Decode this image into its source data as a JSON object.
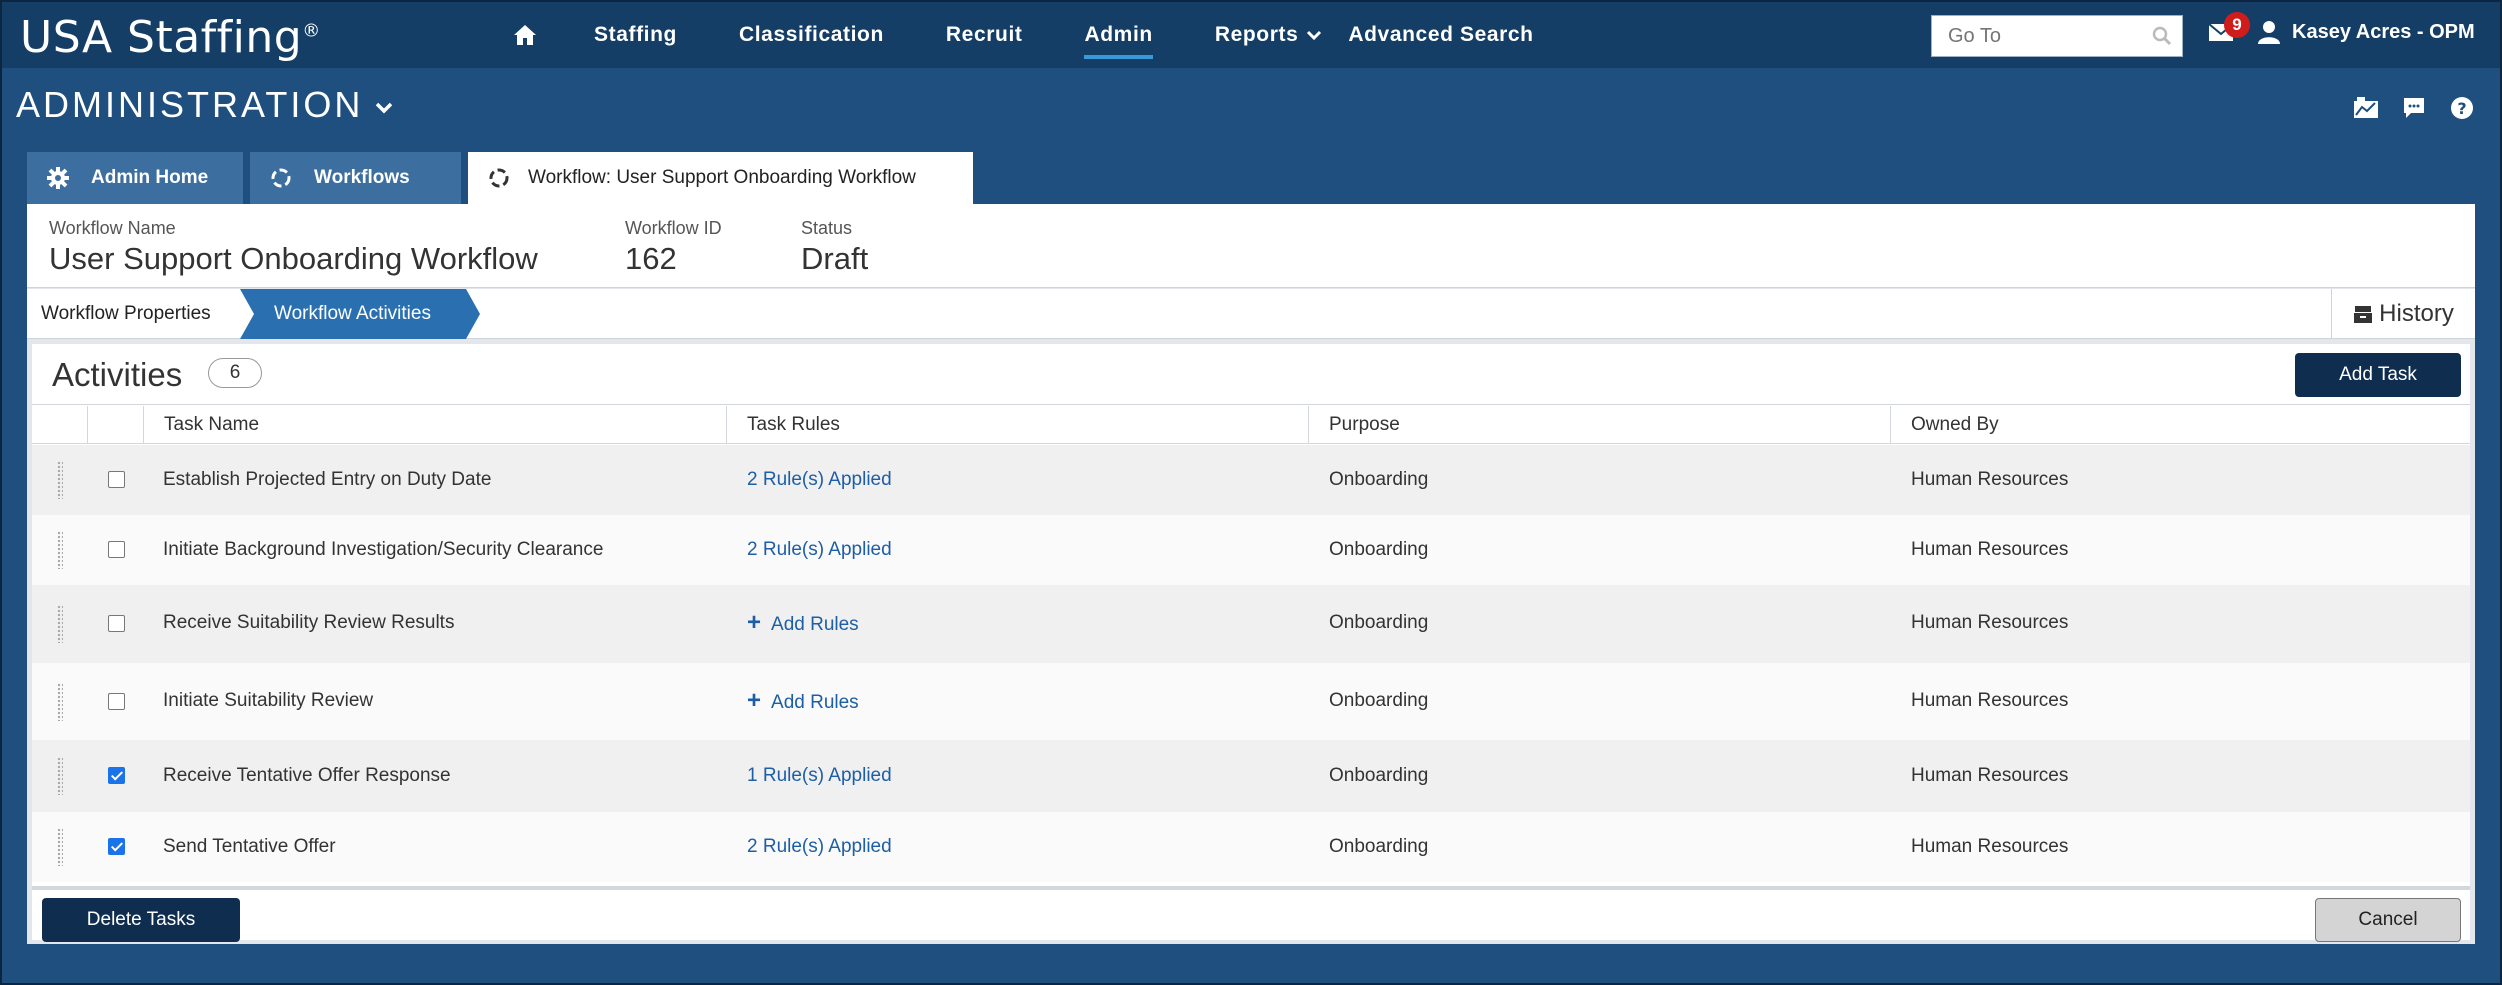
{
  "app": {
    "logo": "USA Staffing",
    "logo_mark": "®"
  },
  "nav": {
    "home_icon": "home-icon",
    "items": [
      {
        "label": "Staffing",
        "active": false
      },
      {
        "label": "Classification",
        "active": false
      },
      {
        "label": "Recruit",
        "active": false
      },
      {
        "label": "Admin",
        "active": true
      },
      {
        "label": "Reports",
        "active": false
      },
      {
        "label": "Advanced Search",
        "active": false
      }
    ],
    "goto_placeholder": "Go To",
    "mail_count": "9",
    "user_name": "Kasey Acres - OPM"
  },
  "section": {
    "title": "ADMINISTRATION"
  },
  "tabs": [
    {
      "label": "Admin Home",
      "icon": "gear-icon"
    },
    {
      "label": "Workflows",
      "icon": "workflow-icon"
    },
    {
      "label": "Workflow: User Support Onboarding Workflow",
      "icon": "workflow-icon"
    }
  ],
  "workflow": {
    "name_label": "Workflow Name",
    "name_value": "User Support Onboarding Workflow",
    "id_label": "Workflow ID",
    "id_value": "162",
    "status_label": "Status",
    "status_value": "Draft"
  },
  "steps": {
    "properties": "Workflow Properties",
    "activities": "Workflow Activities",
    "history": "History"
  },
  "activities": {
    "title": "Activities",
    "count": "6",
    "add_task_label": "Add Task",
    "columns": {
      "task_name": "Task Name",
      "task_rules": "Task Rules",
      "purpose": "Purpose",
      "owned_by": "Owned By"
    },
    "rows": [
      {
        "task": "Establish Projected Entry on Duty Date",
        "rules": "2 Rule(s) Applied",
        "add_rules": false,
        "purpose": "Onboarding",
        "owner": "Human Resources",
        "checked": false
      },
      {
        "task": "Initiate Background Investigation/Security Clearance",
        "rules": "2 Rule(s) Applied",
        "add_rules": false,
        "purpose": "Onboarding",
        "owner": "Human Resources",
        "checked": false
      },
      {
        "task": "Receive Suitability Review Results",
        "rules": "Add Rules",
        "add_rules": true,
        "purpose": "Onboarding",
        "owner": "Human Resources",
        "checked": false
      },
      {
        "task": "Initiate Suitability Review",
        "rules": "Add Rules",
        "add_rules": true,
        "purpose": "Onboarding",
        "owner": "Human Resources",
        "checked": false
      },
      {
        "task": "Receive Tentative Offer Response",
        "rules": "1 Rule(s) Applied",
        "add_rules": false,
        "purpose": "Onboarding",
        "owner": "Human Resources",
        "checked": true
      },
      {
        "task": "Send Tentative Offer",
        "rules": "2 Rule(s) Applied",
        "add_rules": false,
        "purpose": "Onboarding",
        "owner": "Human Resources",
        "checked": true
      }
    ],
    "delete_label": "Delete Tasks",
    "cancel_label": "Cancel"
  },
  "colors": {
    "header": "#153e66",
    "page": "#1f4f7e",
    "accent": "#2a70b0",
    "button": "#0f2e4f",
    "link": "#1d5ea6",
    "badge": "#d11c1c"
  }
}
